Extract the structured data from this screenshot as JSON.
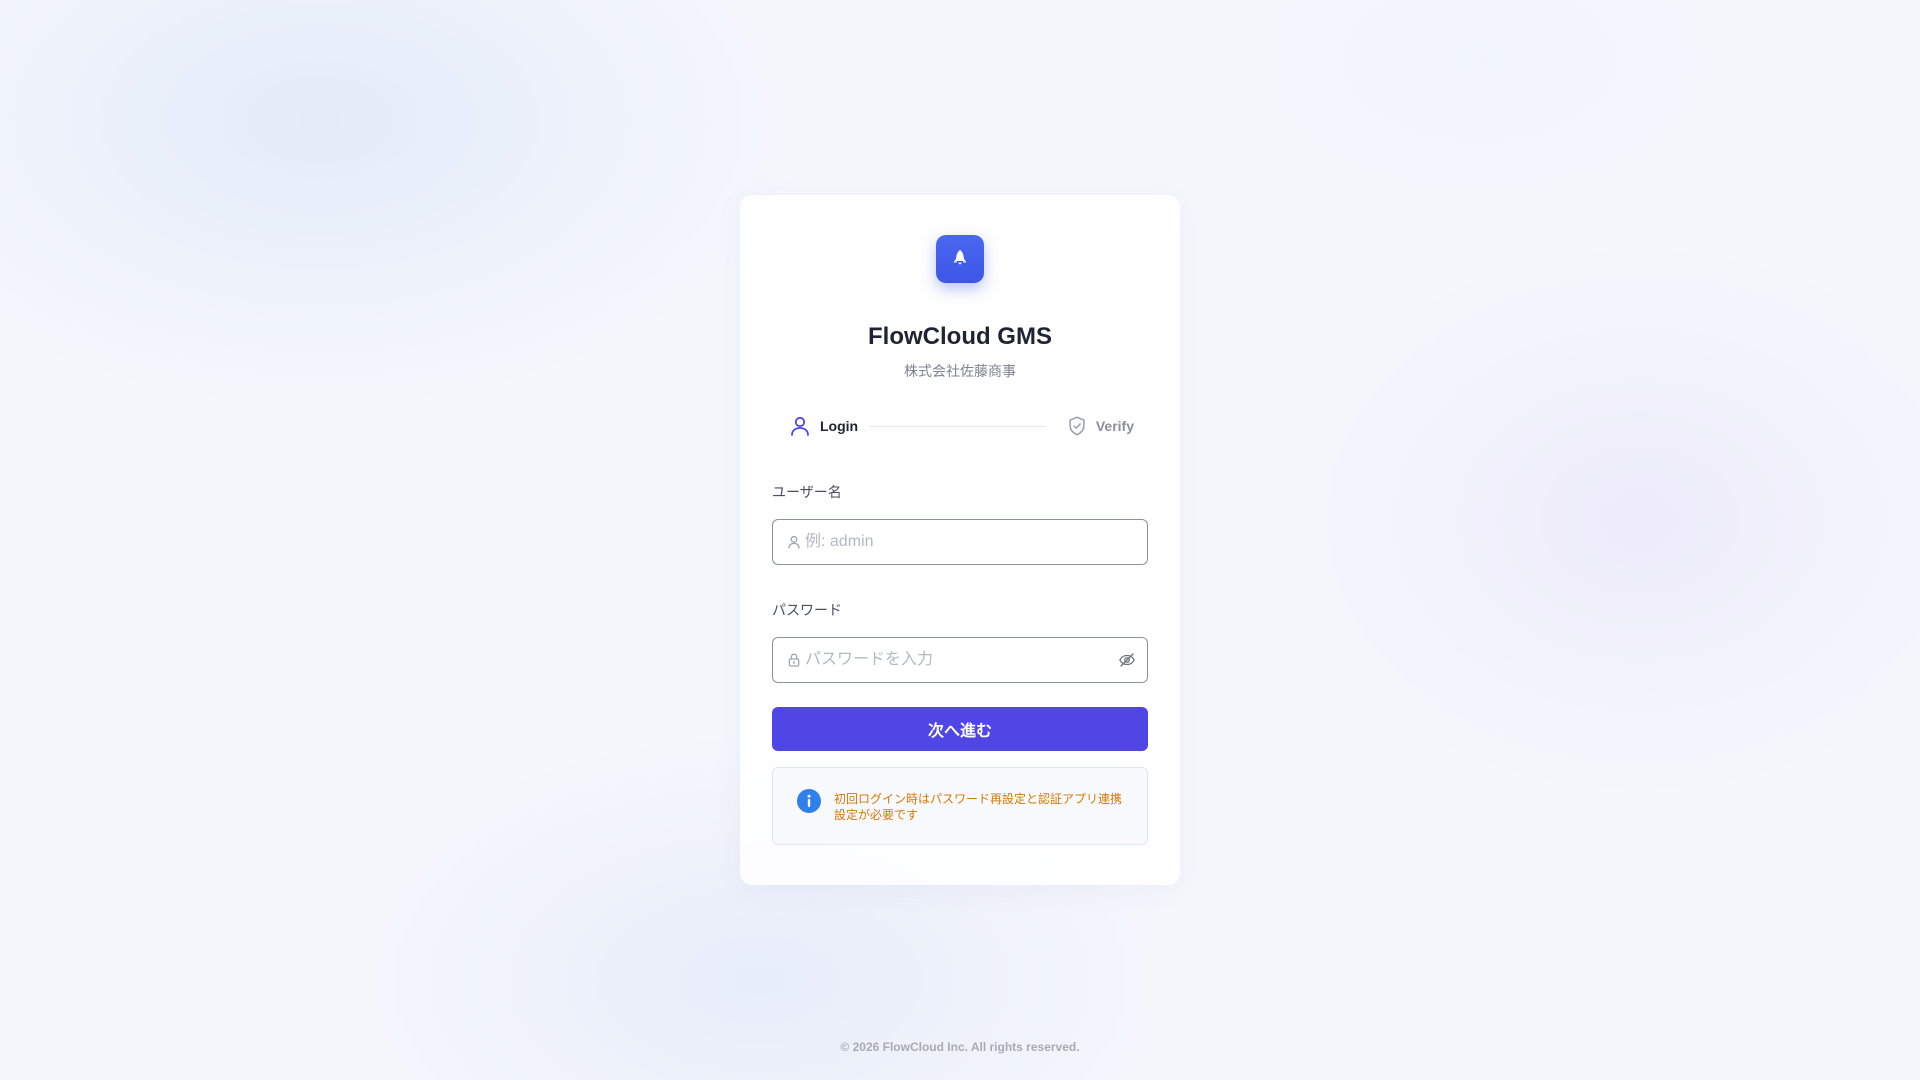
{
  "app": {
    "title": "FlowCloud GMS",
    "company": "株式会社佐藤商事"
  },
  "steps": [
    {
      "label": "Login",
      "icon": "user-icon",
      "active": true
    },
    {
      "label": "Verify",
      "icon": "shield-check-icon",
      "active": false
    }
  ],
  "form": {
    "username": {
      "label": "ユーザー名",
      "value": "",
      "placeholder": "例: admin",
      "icon": "user-icon"
    },
    "password": {
      "label": "パスワード",
      "value": "",
      "placeholder": "パスワードを入力",
      "icon": "lock-icon",
      "toggle_icon": "eye-off-icon"
    },
    "submit_label": "次へ進む"
  },
  "notice": {
    "icon": "info-icon",
    "text": "初回ログイン時はパスワード再設定と認証アプリ連携設定が必要です"
  },
  "footer": {
    "copyright": "© 2026 FlowCloud Inc. All rights reserved."
  },
  "colors": {
    "primary": "#4f46e5",
    "logo": "#3d56e6",
    "notice_text": "#d97706",
    "info": "#2f80ed"
  }
}
